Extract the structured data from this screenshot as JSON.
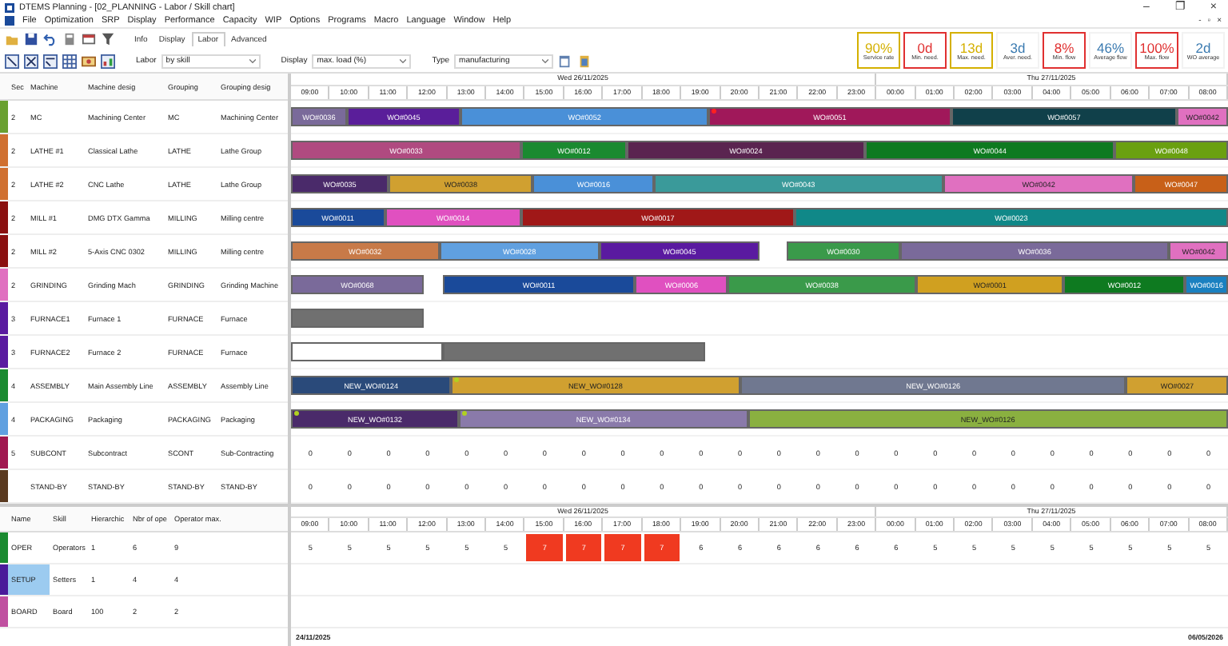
{
  "window": {
    "title": "DTEMS  Planning - [02_PLANNING - Labor / Skill chart]",
    "controls": [
      "–",
      "❐",
      "×"
    ],
    "mdi_controls": [
      "-",
      "▫",
      "×"
    ]
  },
  "menu": [
    "File",
    "Optimization",
    "SRP",
    "Display",
    "Performance",
    "Capacity",
    "WIP",
    "Options",
    "Programs",
    "Macro",
    "Language",
    "Window",
    "Help"
  ],
  "tabs": [
    {
      "label": "Info",
      "selected": false
    },
    {
      "label": "Display",
      "selected": false
    },
    {
      "label": "Labor",
      "selected": true
    },
    {
      "label": "Advanced",
      "selected": false
    }
  ],
  "filters": [
    {
      "label": "Labor",
      "value": "by skill"
    },
    {
      "label": "Display",
      "value": "max. load (%)"
    },
    {
      "label": "Type",
      "value": "manufacturing"
    }
  ],
  "kpis": [
    {
      "value": "90%",
      "label": "Service rate",
      "color": "#d4b000",
      "framed": true
    },
    {
      "value": "0d",
      "label": "Min. need.",
      "color": "#e03030",
      "framed": true
    },
    {
      "value": "13d",
      "label": "Max. need.",
      "color": "#d4b000",
      "framed": true
    },
    {
      "value": "3d",
      "label": "Aver. need.",
      "color": "#3a7ab0",
      "framed": false
    },
    {
      "value": "8%",
      "label": "Min. flow",
      "color": "#e03030",
      "framed": true
    },
    {
      "value": "46%",
      "label": "Average flow",
      "color": "#3a7ab0",
      "framed": false
    },
    {
      "value": "100%",
      "label": "Max. flow",
      "color": "#e03030",
      "framed": true
    },
    {
      "value": "2d",
      "label": "WO average",
      "color": "#3a7ab0",
      "framed": false
    }
  ],
  "machines": {
    "columns": [
      "Sec",
      "Machine",
      "Machine desig",
      "Grouping",
      "Grouping desig"
    ],
    "days": [
      {
        "label": "Wed 26/11/2025",
        "hours": [
          "09:00",
          "10:00",
          "11:00",
          "12:00",
          "13:00",
          "14:00",
          "15:00",
          "16:00",
          "17:00",
          "18:00",
          "19:00",
          "20:00",
          "21:00",
          "22:00",
          "23:00"
        ]
      },
      {
        "label": "Thu 27/11/2025",
        "hours": [
          "00:00",
          "01:00",
          "02:00",
          "03:00",
          "04:00",
          "05:00",
          "06:00",
          "07:00",
          "08:00"
        ]
      }
    ],
    "rows": [
      {
        "color": "#6aa030",
        "sec": "2",
        "machine": "MC",
        "desig": "Machining Center",
        "grouping": "MC",
        "grouping_desig": "Machining Center",
        "kind": "bars",
        "bars": [
          {
            "label": "WO#0036",
            "color": "#7a6a9a"
          },
          {
            "label": "WO#0045",
            "color": "#5a1e9a"
          },
          {
            "label": "WO#0052",
            "color": "#4a90d8"
          },
          {
            "label": "WO#0051",
            "color": "#a0185a",
            "marker": {
              "color": "#ff2020"
            }
          },
          {
            "label": "WO#0057",
            "color": "#10404a"
          },
          {
            "label": "WO#0042",
            "color": "#e070c0"
          }
        ]
      },
      {
        "color": "#d07030",
        "sec": "2",
        "machine": "LATHE #1",
        "desig": "Classical Lathe",
        "grouping": "LATHE",
        "grouping_desig": "Lathe Group",
        "kind": "bars",
        "bars": [
          {
            "label": "WO#0033",
            "color": "#b04a80"
          },
          {
            "label": "WO#0012",
            "color": "#1a8a30"
          },
          {
            "label": "WO#0024",
            "color": "#5a2450"
          },
          {
            "label": "WO#0044",
            "color": "#0e7a20"
          },
          {
            "label": "WO#0048",
            "color": "#6aa010"
          }
        ]
      },
      {
        "color": "#d07030",
        "sec": "2",
        "machine": "LATHE #2",
        "desig": "CNC Lathe",
        "grouping": "LATHE",
        "grouping_desig": "Lathe Group",
        "kind": "bars",
        "bars": [
          {
            "label": "WO#0035",
            "color": "#4a2a6a"
          },
          {
            "label": "WO#0038",
            "color": "#d0a030"
          },
          {
            "label": "WO#0016",
            "color": "#4a90d8"
          },
          {
            "label": "WO#0043",
            "color": "#3a9a9a"
          },
          {
            "label": "WO#0042",
            "color": "#e070c0"
          },
          {
            "label": "WO#0047",
            "color": "#c86018"
          }
        ]
      },
      {
        "color": "#8a1010",
        "sec": "2",
        "machine": "MILL #1",
        "desig": "DMG DTX Gamma",
        "grouping": "MILLING",
        "grouping_desig": "Milling centre",
        "kind": "bars",
        "bars": [
          {
            "label": "WO#0011",
            "color": "#1a4a9a"
          },
          {
            "label": "WO#0014",
            "color": "#e050c0"
          },
          {
            "label": "WO#0017",
            "color": "#a01818"
          },
          {
            "label": "WO#0023",
            "color": "#108888"
          }
        ]
      },
      {
        "color": "#8a1010",
        "sec": "2",
        "machine": "MILL #2",
        "desig": "5-Axis CNC 0302",
        "grouping": "MILLING",
        "grouping_desig": "Milling centre",
        "kind": "bars",
        "bars": [
          {
            "label": "WO#0032",
            "color": "#c87a48"
          },
          {
            "label": "WO#0028",
            "color": "#60a0e0"
          },
          {
            "label": "WO#0045",
            "color": "#5a1aa0"
          },
          {
            "label": "WO#0030",
            "color": "#3a9a4a"
          },
          {
            "label": "WO#0036",
            "color": "#7a6a9a"
          },
          {
            "label": "WO#0042",
            "color": "#e070c0"
          }
        ]
      },
      {
        "color": "#e070c0",
        "sec": "2",
        "machine": "GRINDING",
        "desig": "Grinding Mach",
        "grouping": "GRINDING",
        "grouping_desig": "Grinding Machine",
        "kind": "bars",
        "bars": [
          {
            "label": "WO#0068",
            "color": "#7a6a9a"
          },
          {
            "label": "WO#0011",
            "color": "#1a4a9a"
          },
          {
            "label": "WO#0006",
            "color": "#e050c0"
          },
          {
            "label": "WO#0038",
            "color": "#3a9a4a"
          },
          {
            "label": "WO#0001",
            "color": "#d0a020"
          },
          {
            "label": "WO#0012",
            "color": "#0e7a20"
          },
          {
            "label": "WO#0016",
            "color": "#1a80c0"
          }
        ]
      },
      {
        "color": "#5a1aa0",
        "sec": "3",
        "machine": "FURNACE1",
        "desig": "Furnace 1",
        "grouping": "FURNACE",
        "grouping_desig": "Furnace",
        "kind": "bars",
        "bars": [
          {
            "color": "#707070"
          }
        ]
      },
      {
        "color": "#5a1aa0",
        "sec": "3",
        "machine": "FURNACE2",
        "desig": "Furnace 2",
        "grouping": "FURNACE",
        "grouping_desig": "Furnace",
        "kind": "bars",
        "bars": [
          {
            "color": "#ffffff"
          },
          {
            "color": "#707070"
          }
        ]
      },
      {
        "color": "#1a8a30",
        "sec": "4",
        "machine": "ASSEMBLY",
        "desig": "Main Assembly Line",
        "grouping": "ASSEMBLY",
        "grouping_desig": "Assembly Line",
        "kind": "bars",
        "bars": [
          {
            "label": "NEW_WO#0124",
            "color": "#2a4a7a"
          },
          {
            "label": "NEW_WO#0128",
            "color": "#d0a030",
            "marker": {
              "color": "#b0d020"
            }
          },
          {
            "label": "NEW_WO#0126",
            "color": "#707890"
          },
          {
            "label": "WO#0027",
            "color": "#d0a030"
          }
        ]
      },
      {
        "color": "#60a0e0",
        "sec": "4",
        "machine": "PACKAGING",
        "desig": "Packaging",
        "grouping": "PACKAGING",
        "grouping_desig": "Packaging",
        "kind": "bars",
        "bars": [
          {
            "label": "NEW_WO#0132",
            "color": "#4a2a6a",
            "marker": {
              "color": "#b0d020"
            }
          },
          {
            "label": "NEW_WO#0134",
            "color": "#8a7aaa",
            "marker": {
              "color": "#b0d020"
            }
          },
          {
            "label": "NEW_WO#0126",
            "color": "#8ab040"
          }
        ]
      },
      {
        "color": "#a01850",
        "sec": "5",
        "machine": "SUBCONT",
        "desig": "Subcontract",
        "grouping": "SCONT",
        "grouping_desig": "Sub-Contracting",
        "kind": "values",
        "values": [
          "0",
          "0",
          "0",
          "0",
          "0",
          "0",
          "0",
          "0",
          "0",
          "0",
          "0",
          "0",
          "0",
          "0",
          "0",
          "0",
          "0",
          "0",
          "0",
          "0",
          "0",
          "0",
          "0",
          "0"
        ]
      },
      {
        "color": "#5a3a20",
        "machine": "STAND-BY",
        "desig": "STAND-BY",
        "grouping": "STAND-BY",
        "grouping_desig": "STAND-BY",
        "kind": "values",
        "values": [
          "0",
          "0",
          "0",
          "0",
          "0",
          "0",
          "0",
          "0",
          "0",
          "0",
          "0",
          "0",
          "0",
          "0",
          "0",
          "0",
          "0",
          "0",
          "0",
          "0",
          "0",
          "0",
          "0",
          "0"
        ]
      }
    ]
  },
  "operators": {
    "columns": [
      "Name",
      "Skill",
      "Hierarchic",
      "Nbr of ope",
      "Operator max."
    ],
    "days": [
      {
        "label": "Wed 26/11/2025",
        "hours": [
          "09:00",
          "10:00",
          "11:00",
          "12:00",
          "13:00",
          "14:00",
          "15:00",
          "16:00",
          "17:00",
          "18:00",
          "19:00",
          "20:00",
          "21:00",
          "22:00",
          "23:00"
        ]
      },
      {
        "label": "Thu 27/11/2025",
        "hours": [
          "00:00",
          "01:00",
          "02:00",
          "03:00",
          "04:00",
          "05:00",
          "06:00",
          "07:00",
          "08:00"
        ]
      }
    ],
    "rows": [
      {
        "color": "#1a8a30",
        "name": "OPER",
        "skill": "Operators",
        "hierarchy": "1",
        "count": "6",
        "max": "9",
        "selected": false,
        "cells": [
          {
            "value": "5",
            "overload": false
          },
          {
            "value": "5",
            "overload": false
          },
          {
            "value": "5",
            "overload": false
          },
          {
            "value": "5",
            "overload": false
          },
          {
            "value": "5",
            "overload": false
          },
          {
            "value": "5",
            "overload": false
          },
          {
            "value": "7",
            "overload": true
          },
          {
            "value": "7",
            "overload": true
          },
          {
            "value": "7",
            "overload": true
          },
          {
            "value": "7",
            "overload": true
          },
          {
            "value": "6",
            "overload": false
          },
          {
            "value": "6",
            "overload": false
          },
          {
            "value": "6",
            "overload": false
          },
          {
            "value": "6",
            "overload": false
          },
          {
            "value": "6",
            "overload": false
          },
          {
            "value": "6",
            "overload": false
          },
          {
            "value": "5",
            "overload": false
          },
          {
            "value": "5",
            "overload": false
          },
          {
            "value": "5",
            "overload": false
          },
          {
            "value": "5",
            "overload": false
          },
          {
            "value": "5",
            "overload": false
          },
          {
            "value": "5",
            "overload": false
          },
          {
            "value": "5",
            "overload": false
          },
          {
            "value": "5",
            "overload": false
          }
        ]
      },
      {
        "color": "#4a1a9a",
        "name": "SETUP",
        "skill": "Setters",
        "hierarchy": "1",
        "count": "4",
        "max": "4",
        "selected": true
      },
      {
        "color": "#c050a0",
        "name": "BOARD",
        "skill": "Board",
        "hierarchy": "100",
        "count": "2",
        "max": "2",
        "selected": false
      }
    ]
  },
  "footer": {
    "start": "24/11/2025",
    "end": "06/05/2026"
  }
}
